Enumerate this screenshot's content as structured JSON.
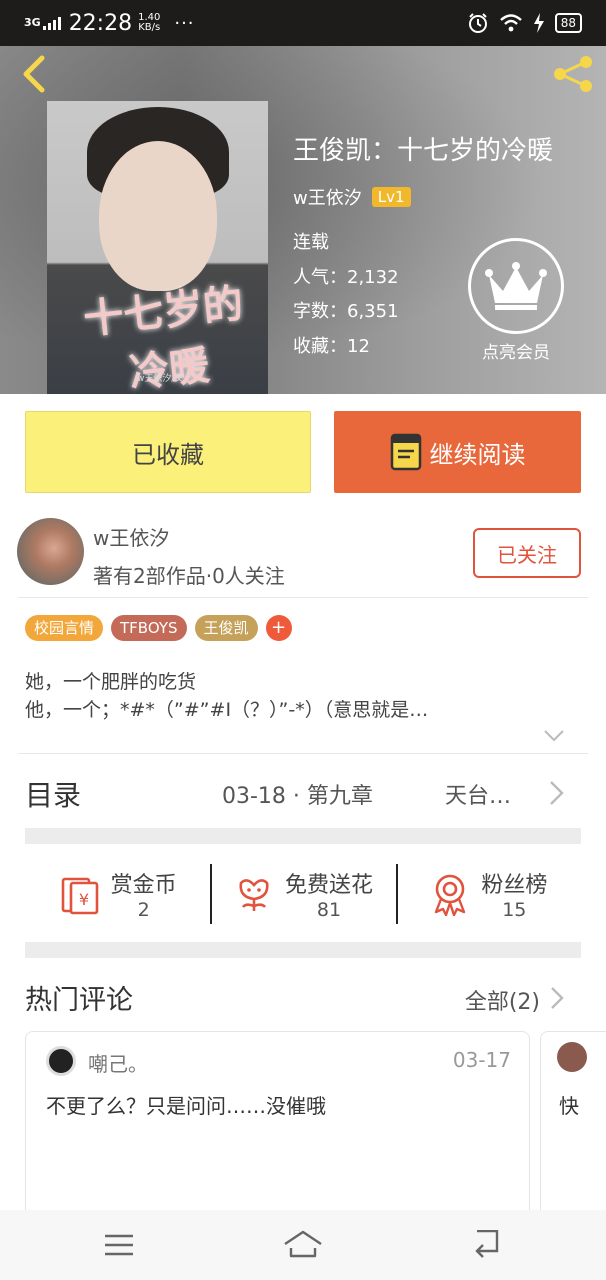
{
  "status_bar": {
    "network": "3G",
    "time": "22:28",
    "speed_value": "1.40",
    "speed_unit": "KB/s",
    "more": "···",
    "battery": "88"
  },
  "book": {
    "title": "王俊凯：十七岁的冷暖",
    "author": "w王依汐",
    "level": "Lv1",
    "status": "连载",
    "popularity": "人气：2,132",
    "word_count": "字数：6,351",
    "favorites": "收藏：12",
    "vip_label": "点亮会员",
    "cover_art_title": "十七岁的冷暖",
    "cover_art_author": "w王依汐/文"
  },
  "actions": {
    "collect_label": "已收藏",
    "read_label": "继续阅读"
  },
  "author_block": {
    "name": "w王依汐",
    "works": "著有2部作品·0人关注",
    "follow_label": "已关注"
  },
  "tags": [
    {
      "label": "校园言情",
      "color": "#f2a73b"
    },
    {
      "label": "TFBOYS",
      "color": "#c46a58"
    },
    {
      "label": "王俊凯",
      "color": "#c6a15a"
    }
  ],
  "tag_add": "+",
  "description": [
    "她，一个肥胖的吃货",
    "他，一个；*#*（”#”#I（？）”-*）（意思就是…"
  ],
  "catalog": {
    "title": "目录",
    "latest": "03-18 · 第九章",
    "chapter_name": "天台…"
  },
  "rewards": [
    {
      "label": "赏金币",
      "count": "2",
      "icon": "red-envelope-icon"
    },
    {
      "label": "免费送花",
      "count": "81",
      "icon": "flower-icon"
    },
    {
      "label": "粉丝榜",
      "count": "15",
      "icon": "medal-icon"
    }
  ],
  "comments": {
    "title": "热门评论",
    "all_label": "全部(2)",
    "items": [
      {
        "user": "嘲己。",
        "date": "03-17",
        "text": "不更了么？只是问问……没催哦"
      },
      {
        "text": "快"
      }
    ]
  },
  "colors": {
    "accent_orange": "#e8683b",
    "collect_yellow": "#faf07a",
    "follow_red": "#e0533c",
    "level_gold": "#f2b82b"
  }
}
